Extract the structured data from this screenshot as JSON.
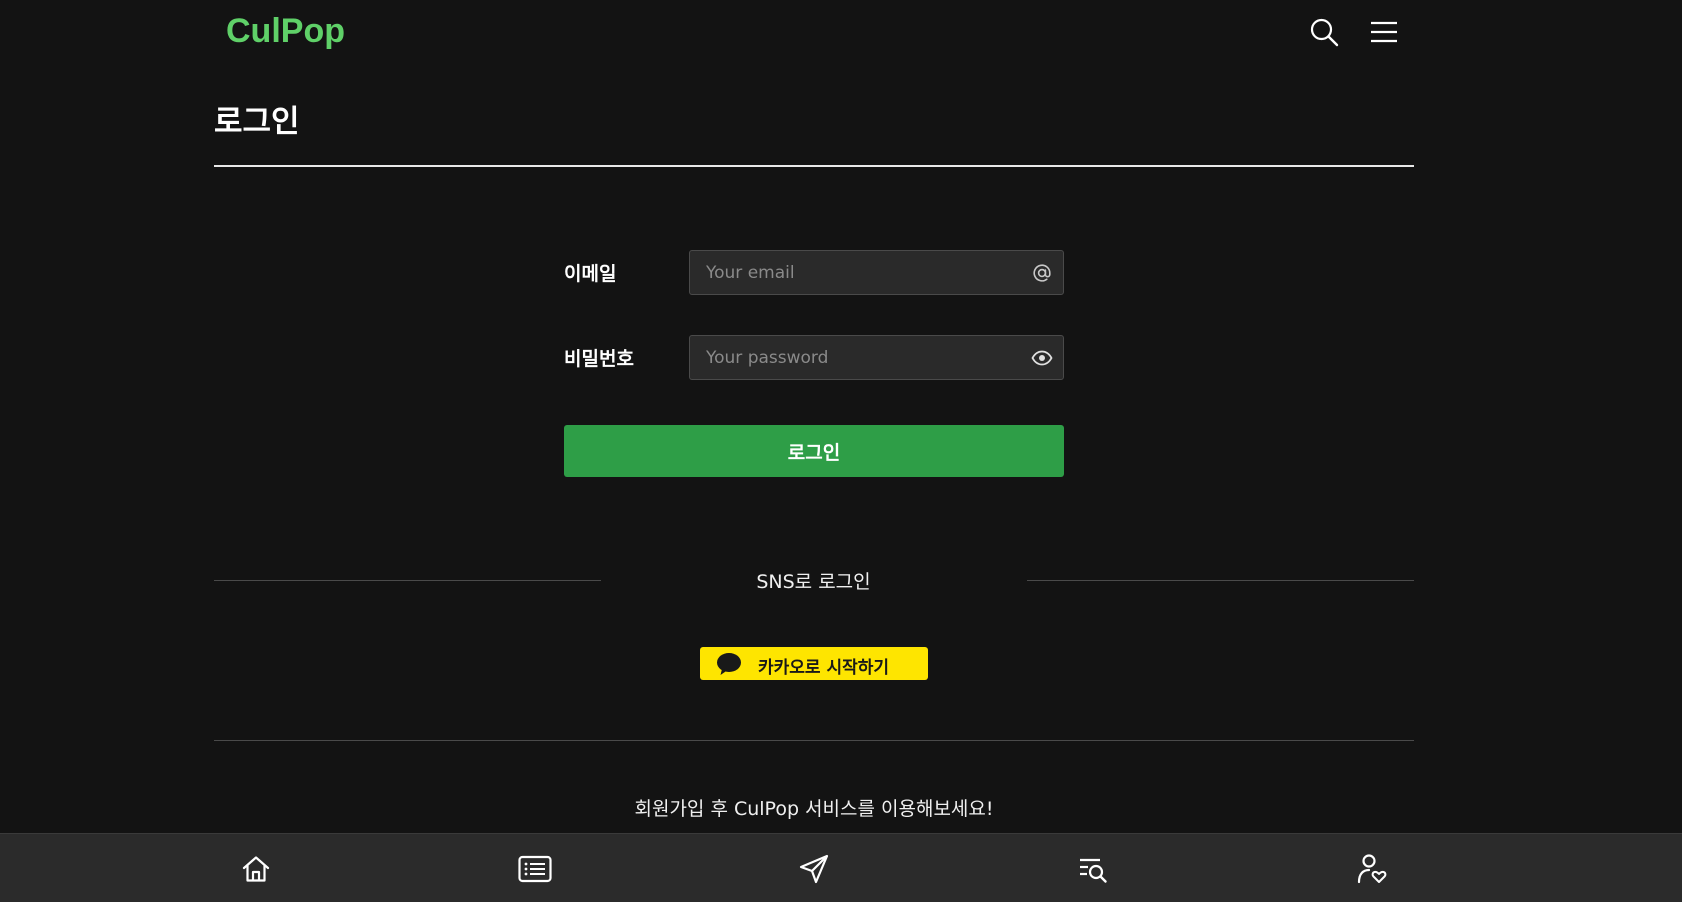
{
  "header": {
    "logo": "CulPop",
    "icons": [
      "search-icon",
      "hamburger-menu-icon"
    ]
  },
  "page": {
    "title": "로그인"
  },
  "form": {
    "email_label": "이메일",
    "email_placeholder": "Your email",
    "email_value": "",
    "email_icon": "at-sign-icon",
    "password_label": "비밀번호",
    "password_placeholder": "Your password",
    "password_value": "",
    "password_icon": "eye-icon",
    "login_button": "로그인"
  },
  "sns": {
    "title": "SNS로 로그인",
    "kakao_label": "카카오로 시작하기",
    "kakao_icon": "speech-bubble-icon"
  },
  "signup": {
    "text": "회원가입 후 CulPop 서비스를 이용해보세요!"
  },
  "bottom_nav": {
    "icons": [
      "home-icon",
      "list-icon",
      "send-icon",
      "search-list-icon",
      "user-heart-icon"
    ]
  },
  "colors": {
    "background": "#131313",
    "brand": "#5fd068",
    "login_button": "#2e9e47",
    "kakao": "#fee500",
    "nav_background": "#2b2b2b"
  }
}
